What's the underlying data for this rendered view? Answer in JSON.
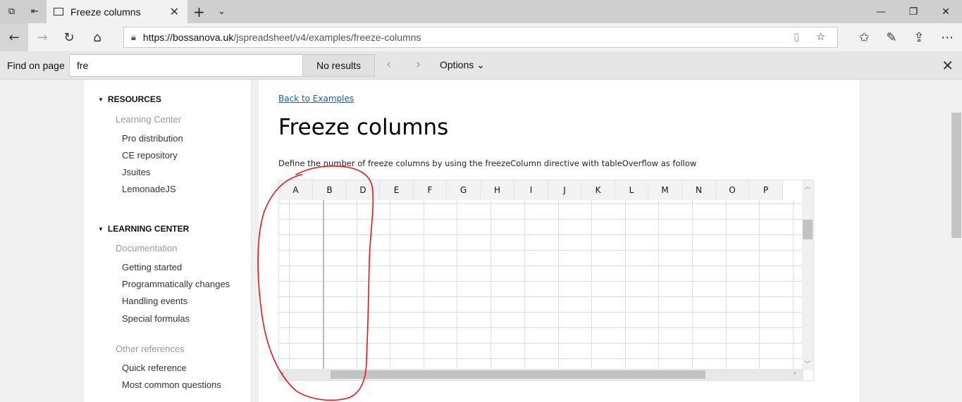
{
  "browser": {
    "tab_title": "Freeze columns",
    "url_host": "https://bossanova.uk",
    "url_path": "/jspreadsheet/v4/examples/freeze-columns"
  },
  "find": {
    "label": "Find on page",
    "query": "fre",
    "results": "No results",
    "options_label": "Options"
  },
  "sidebar": {
    "resources_title": "RESOURCES",
    "learning_center_sub": "Learning Center",
    "resource_links": [
      "Pro distribution",
      "CE repository",
      "Jsuites",
      "LemonadeJS"
    ],
    "learning_title": "LEARNING CENTER",
    "documentation_sub": "Documentation",
    "doc_links": [
      "Getting started",
      "Programmatically changes",
      "Handling events",
      "Special formulas"
    ],
    "other_sub": "Other references",
    "other_links": [
      "Quick reference",
      "Most common questions"
    ]
  },
  "content": {
    "back_link": "Back to Examples",
    "title": "Freeze columns",
    "description": "Define the number of freeze columns by using the freezeColumn directive with tableOverflow as follow"
  },
  "sheet": {
    "columns": [
      "A",
      "B",
      "D",
      "E",
      "F",
      "G",
      "H",
      "I",
      "J",
      "K",
      "L",
      "M",
      "N",
      "O",
      "P"
    ]
  },
  "colors": {
    "link": "#0066cc",
    "annotation": "#e8141b"
  }
}
